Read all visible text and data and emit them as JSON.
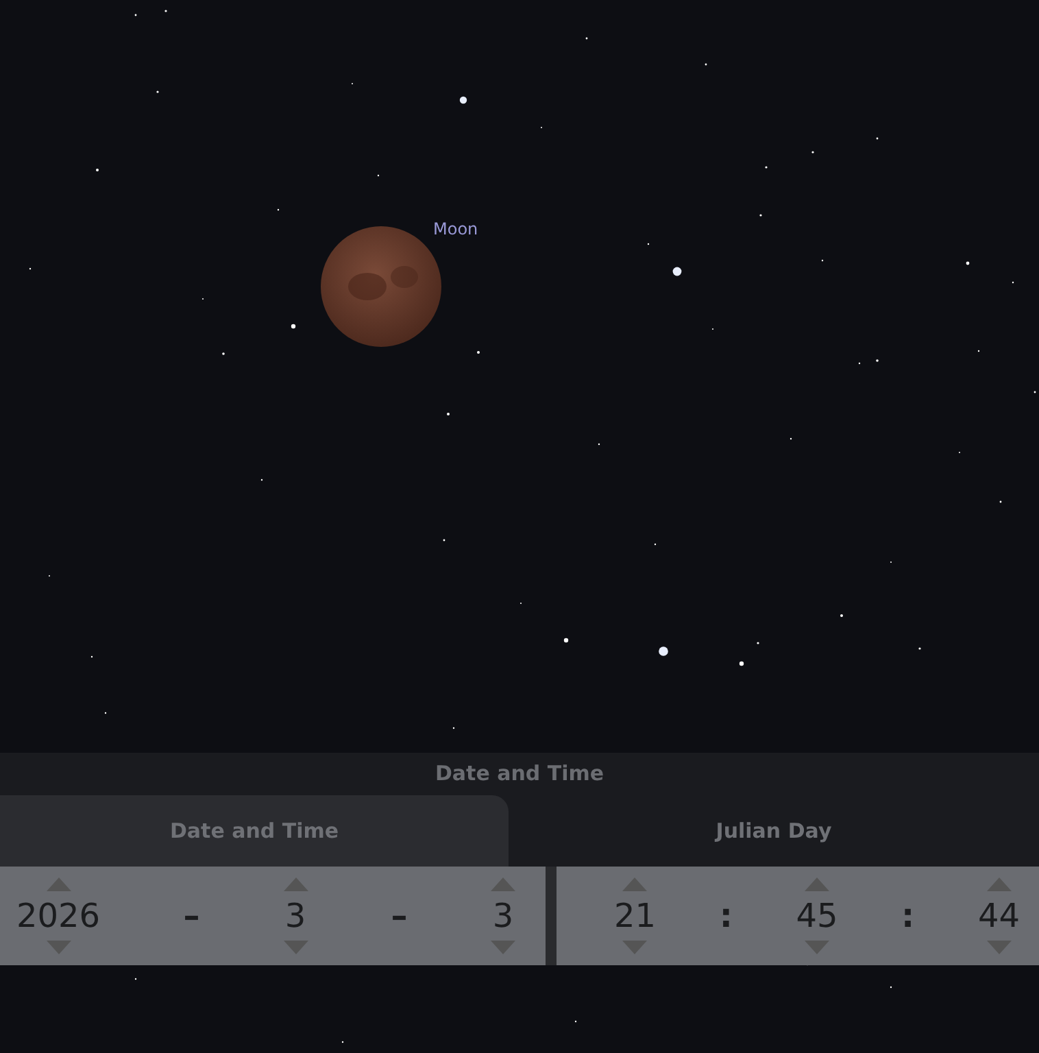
{
  "sky": {
    "object_label": "Moon"
  },
  "dialog": {
    "title": "Date and Time",
    "tabs": [
      {
        "label": "Date and Time",
        "selected": true
      },
      {
        "label": "Julian Day",
        "selected": false
      }
    ],
    "date": {
      "fields": [
        "2026",
        "3",
        "3"
      ],
      "separator": "–"
    },
    "time": {
      "fields": [
        "21",
        "45",
        "44"
      ],
      "separator": ":"
    }
  }
}
